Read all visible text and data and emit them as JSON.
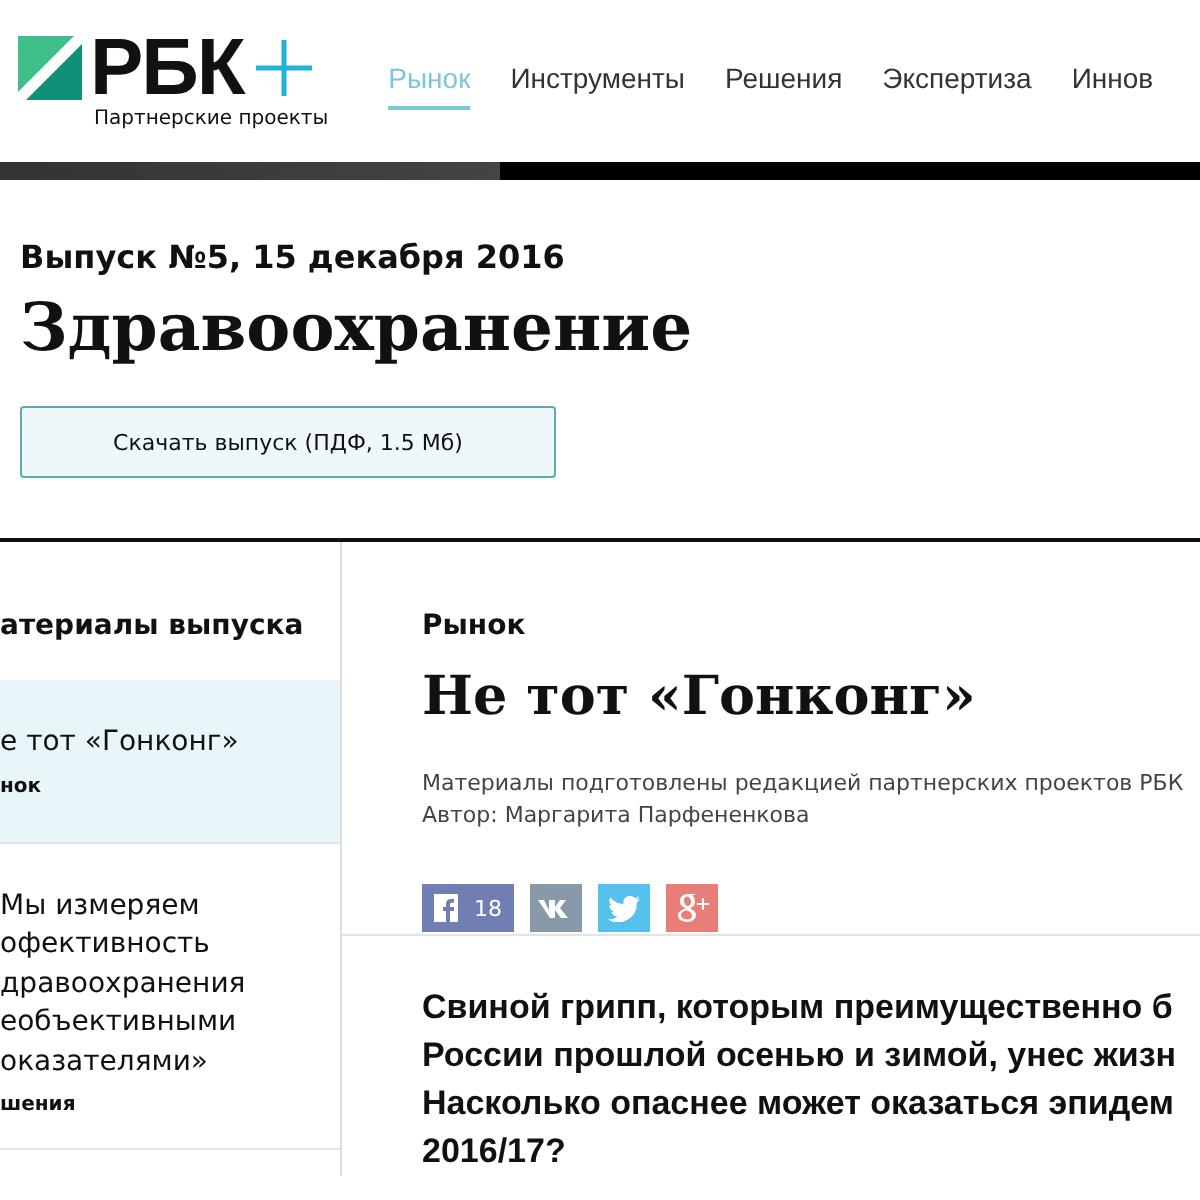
{
  "logo": {
    "text": "РБК",
    "tagline": "Партнерские проекты"
  },
  "nav": [
    {
      "label": "Рынок",
      "selected": true
    },
    {
      "label": "Инструменты",
      "selected": false
    },
    {
      "label": "Решения",
      "selected": false
    },
    {
      "label": "Экспертиза",
      "selected": false
    },
    {
      "label": "Иннов",
      "selected": false
    }
  ],
  "issue": {
    "subtitle": "Выпуск №5, 15 декабря 2016",
    "title": "Здравоохранение",
    "download": "Скачать выпуск (ПДФ, 1.5 Мб)"
  },
  "sidebar": {
    "heading": "атериалы выпуска",
    "items": [
      {
        "title_lines": [
          "е тот «Гонконг»"
        ],
        "section": "нок",
        "selected": true
      },
      {
        "title_lines": [
          "Мы измеряем",
          "офективность",
          "дравоохранения",
          "еобъективными",
          "оказателями»"
        ],
        "section": "шения",
        "selected": false
      }
    ]
  },
  "article": {
    "section": "Рынок",
    "title": "Не тот «Гонконг»",
    "credits": "Материалы подготовлены редакцией партнерских проектов РБК",
    "author": "Автор: Маргарита Парфененкова",
    "share": [
      {
        "kind": "facebook",
        "count": "18"
      },
      {
        "kind": "vk"
      },
      {
        "kind": "twitter"
      },
      {
        "kind": "googleplus"
      }
    ],
    "lead_lines": [
      "Свиной грипп, которым преимущественно б",
      "России прошлой осенью и зимой, унес жизн",
      "Насколько опаснее может оказаться эпидем",
      "2016/17?"
    ]
  }
}
